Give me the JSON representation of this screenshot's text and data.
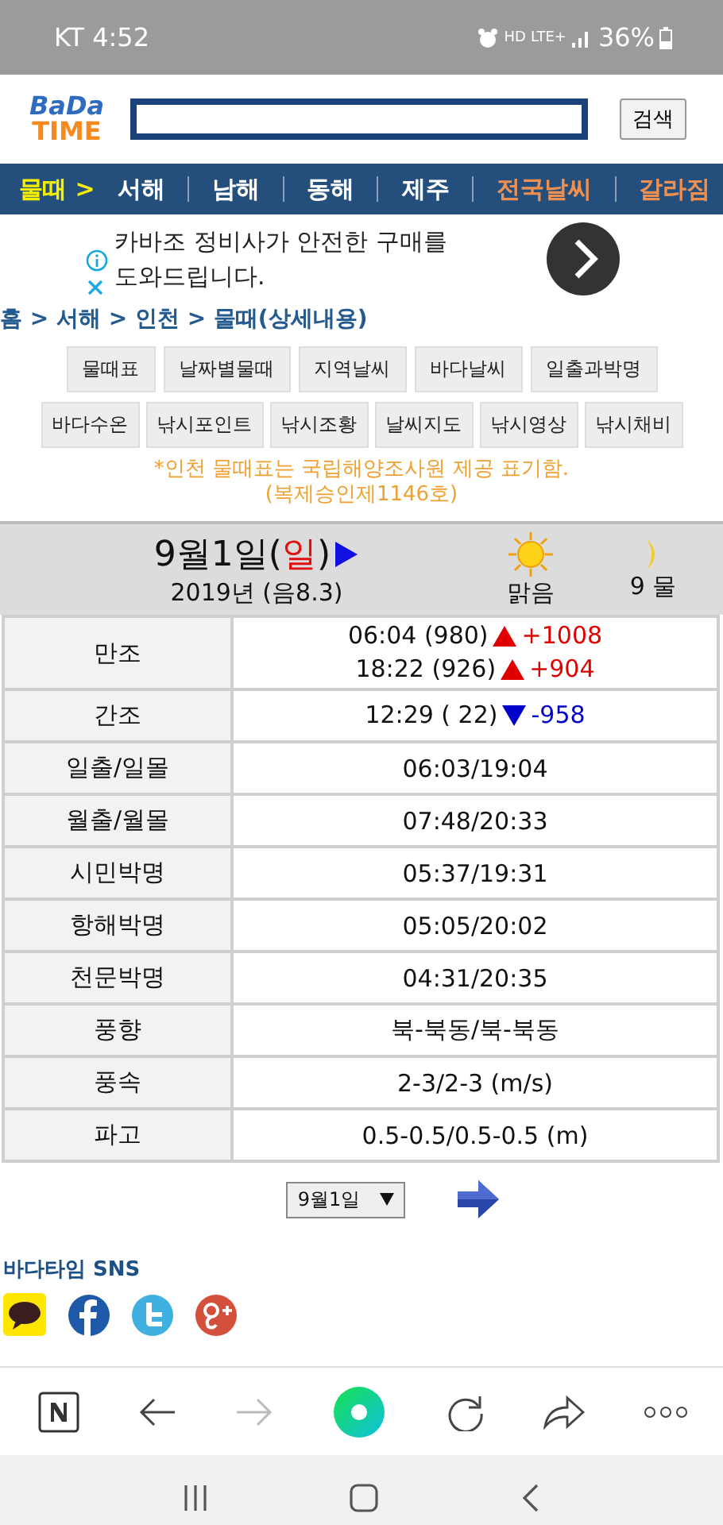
{
  "status_bar": {
    "carrier_time": "KT 4:52",
    "indicators": [
      "HD",
      "LTE+"
    ],
    "battery": "36%"
  },
  "header": {
    "logo_top": "BaDa",
    "logo_bottom": "TIME",
    "search_button": "검색"
  },
  "nav": [
    {
      "label": "물때 >",
      "kind": "current"
    },
    {
      "label": "서해",
      "kind": "region"
    },
    {
      "label": "남해",
      "kind": "region"
    },
    {
      "label": "동해",
      "kind": "region"
    },
    {
      "label": "제주",
      "kind": "region"
    },
    {
      "label": "전국날씨",
      "kind": "highlight"
    },
    {
      "label": "갈라짐",
      "kind": "highlight"
    }
  ],
  "ad": {
    "text": "카바조 정비사가 안전한 구매를 도와드립니다."
  },
  "breadcrumb": "홈 > 서해 > 인천 > 물때(상세내용)",
  "menu_rows": [
    [
      "물때표",
      "날짜별물때",
      "지역날씨",
      "바다날씨",
      "일출과박명"
    ],
    [
      "바다수온",
      "낚시포인트",
      "낚시조황",
      "날씨지도",
      "낚시영상",
      "낚시채비"
    ]
  ],
  "notice": [
    "*인천 물때표는 국립해양조사원 제공 표기함.",
    "(복제승인제1146호)"
  ],
  "day": {
    "before": "9월1일(",
    "weekday": "일",
    "after": ")",
    "lunar": "2019년 (음8.3)",
    "weather": "맑음",
    "tide_phase": "9 물"
  },
  "table": [
    {
      "label": "만조",
      "kind": "tide",
      "entries": [
        {
          "text": "06:04 (980)",
          "rising": true,
          "change": "+1008"
        },
        {
          "text": "18:22 (926)",
          "rising": true,
          "change": "+904"
        }
      ]
    },
    {
      "label": "간조",
      "kind": "tide",
      "entries": [
        {
          "text": "12:29 ( 22)",
          "rising": false,
          "change": "-958"
        }
      ]
    },
    {
      "label": "일출/일몰",
      "kind": "text",
      "value": "06:03/19:04"
    },
    {
      "label": "월출/월몰",
      "kind": "text",
      "value": "07:48/20:33"
    },
    {
      "label": "시민박명",
      "kind": "text",
      "value": "05:37/19:31"
    },
    {
      "label": "항해박명",
      "kind": "text",
      "value": "05:05/20:02"
    },
    {
      "label": "천문박명",
      "kind": "text",
      "value": "04:31/20:35"
    },
    {
      "label": "풍향",
      "kind": "text",
      "value": "북-북동/북-북동"
    },
    {
      "label": "풍속",
      "kind": "text",
      "value": "2-3/2-3 (m/s)"
    },
    {
      "label": "파고",
      "kind": "text",
      "value": "0.5-0.5/0.5-0.5 (m)"
    }
  ],
  "date_select": "9월1일",
  "sns": {
    "title": "바다타임 SNS"
  }
}
